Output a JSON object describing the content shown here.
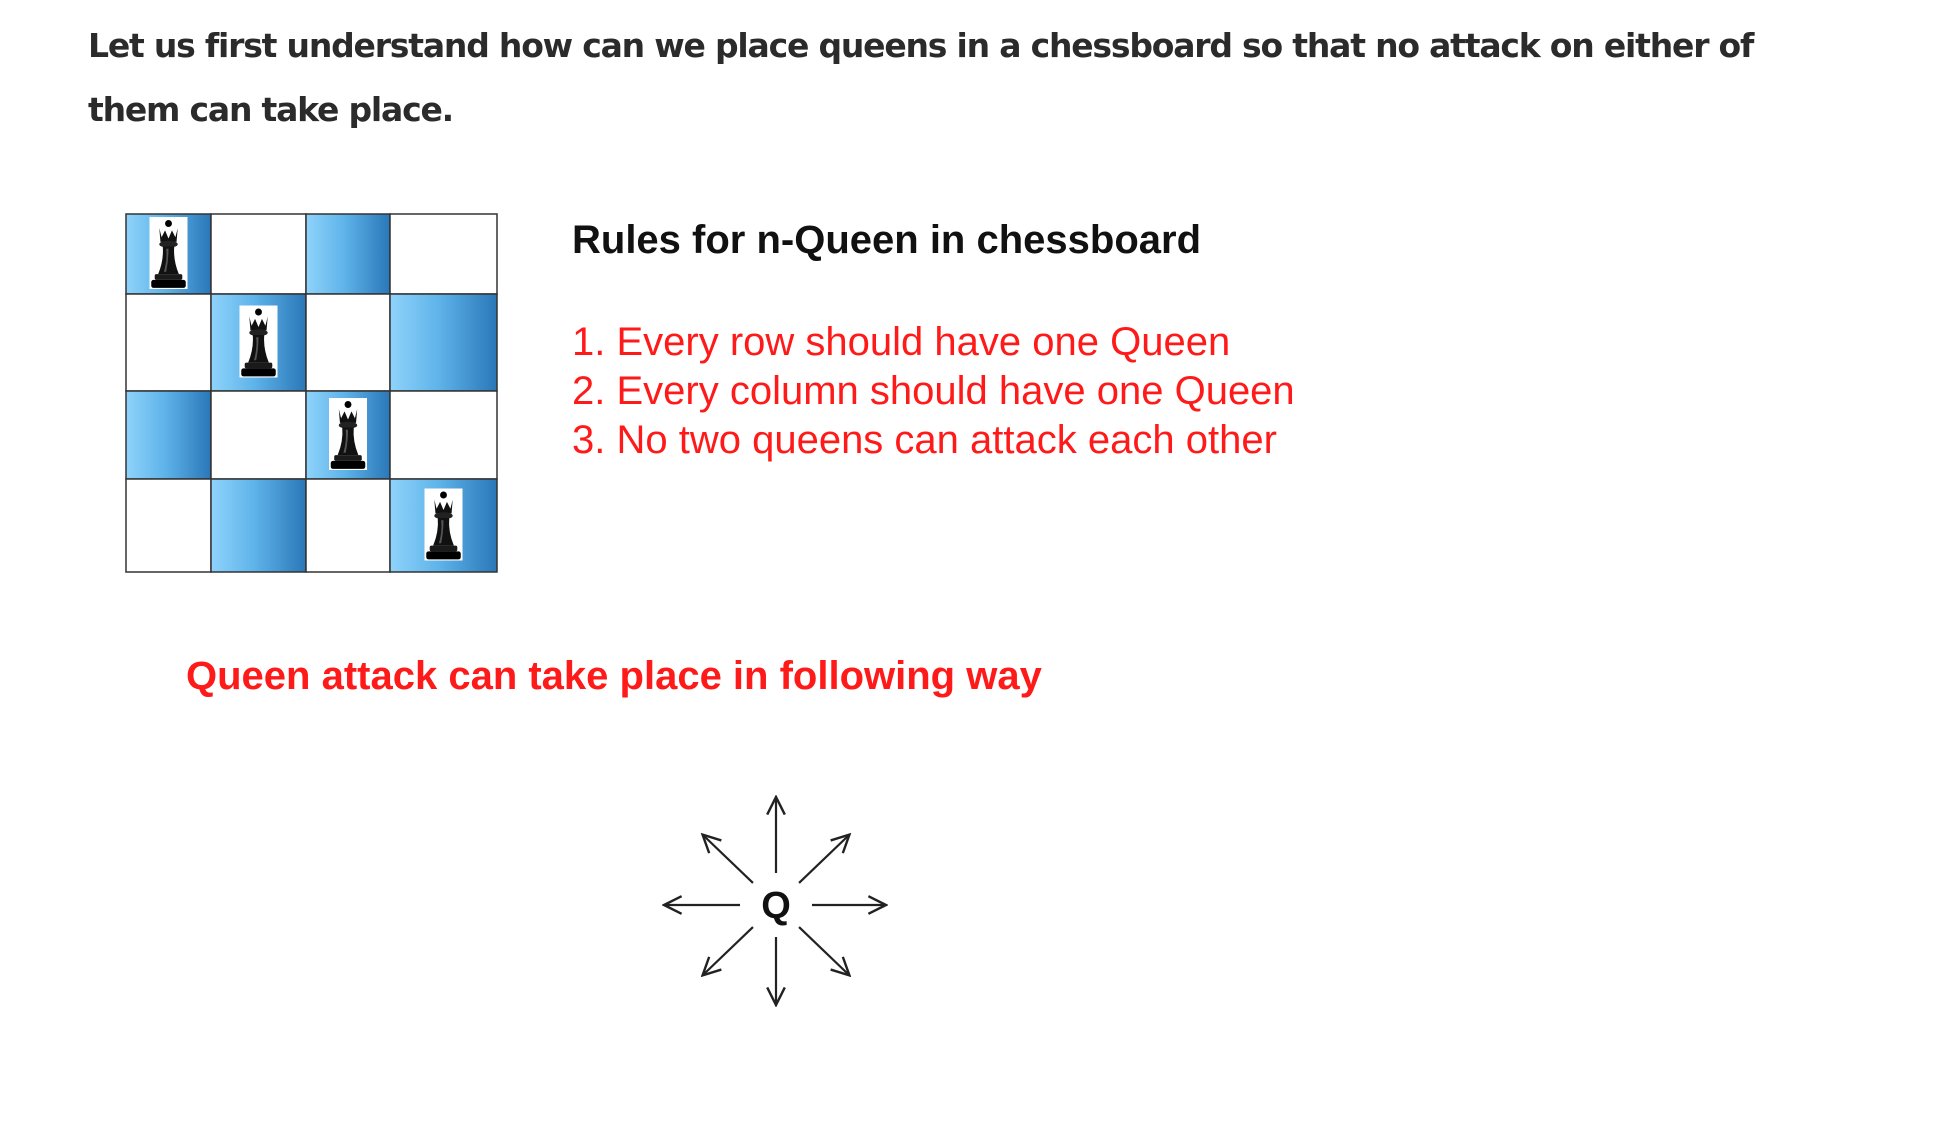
{
  "intro": {
    "text": "Let us first understand how can we place queens in a chessboard so that no attack on either of them can take place."
  },
  "board": {
    "size": 4,
    "queen_cells": [
      [
        0,
        0
      ],
      [
        1,
        1
      ],
      [
        2,
        2
      ],
      [
        3,
        3
      ]
    ],
    "shaded_cells": [
      [
        0,
        0
      ],
      [
        0,
        2
      ],
      [
        1,
        1
      ],
      [
        1,
        3
      ],
      [
        2,
        0
      ],
      [
        2,
        2
      ],
      [
        3,
        1
      ],
      [
        3,
        3
      ]
    ],
    "queen_icon": "black-queen-icon",
    "colors": {
      "shade_light": "#7cc8f5",
      "shade_dark": "#2f7fc0",
      "light": "#ffffff",
      "grid": "#333333"
    }
  },
  "rules": {
    "title": "Rules for n-Queen in chessboard",
    "items": [
      "1. Every row should have one Queen",
      "2. Every column should have one Queen",
      "3. No two queens can attack each other"
    ],
    "color": "#ff1a1a"
  },
  "attack": {
    "title": "Queen attack can take place in following way",
    "center_label": "Q",
    "directions": [
      "up",
      "up-right",
      "right",
      "down-right",
      "down",
      "down-left",
      "left",
      "up-left"
    ],
    "arrow_icon": "arrow-icon"
  }
}
